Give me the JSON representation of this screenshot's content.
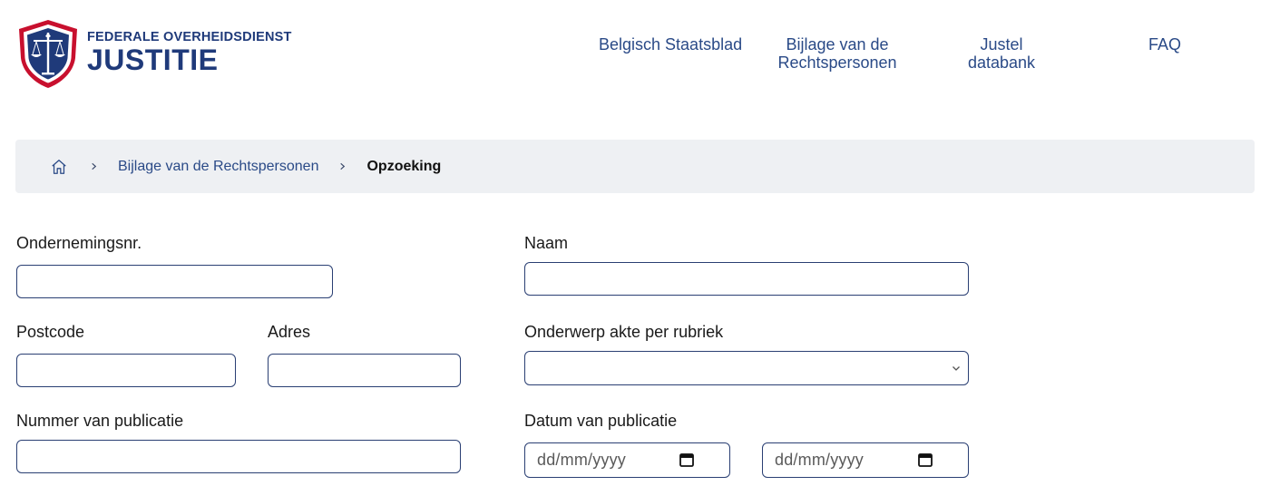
{
  "brand": {
    "top": "FEDERALE OVERHEIDSDIENST",
    "main": "JUSTITIE"
  },
  "nav": [
    {
      "label": "Belgisch Staatsblad"
    },
    {
      "label": "Bijlage van de Rechtspersonen"
    },
    {
      "label": "Justel databank"
    },
    {
      "label": "FAQ"
    }
  ],
  "breadcrumb": {
    "home_icon": "home-icon",
    "link": "Bijlage van de Rechtspersonen",
    "current": "Opzoeking"
  },
  "form": {
    "ondernemingsnr_label": "Ondernemingsnr.",
    "naam_label": "Naam",
    "postcode_label": "Postcode",
    "adres_label": "Adres",
    "onderwerp_label": "Onderwerp akte per rubriek",
    "nummer_label": "Nummer van publicatie",
    "datum_label": "Datum van publicatie",
    "date_from_placeholder": "dd/mm/yyyy",
    "date_to_placeholder": "dd/mm/yyyy"
  },
  "colors": {
    "brand_blue": "#1f3a7a",
    "link_blue": "#2a4a87",
    "shield_red": "#c8102e",
    "breadcrumb_bg": "#eef0f3"
  }
}
